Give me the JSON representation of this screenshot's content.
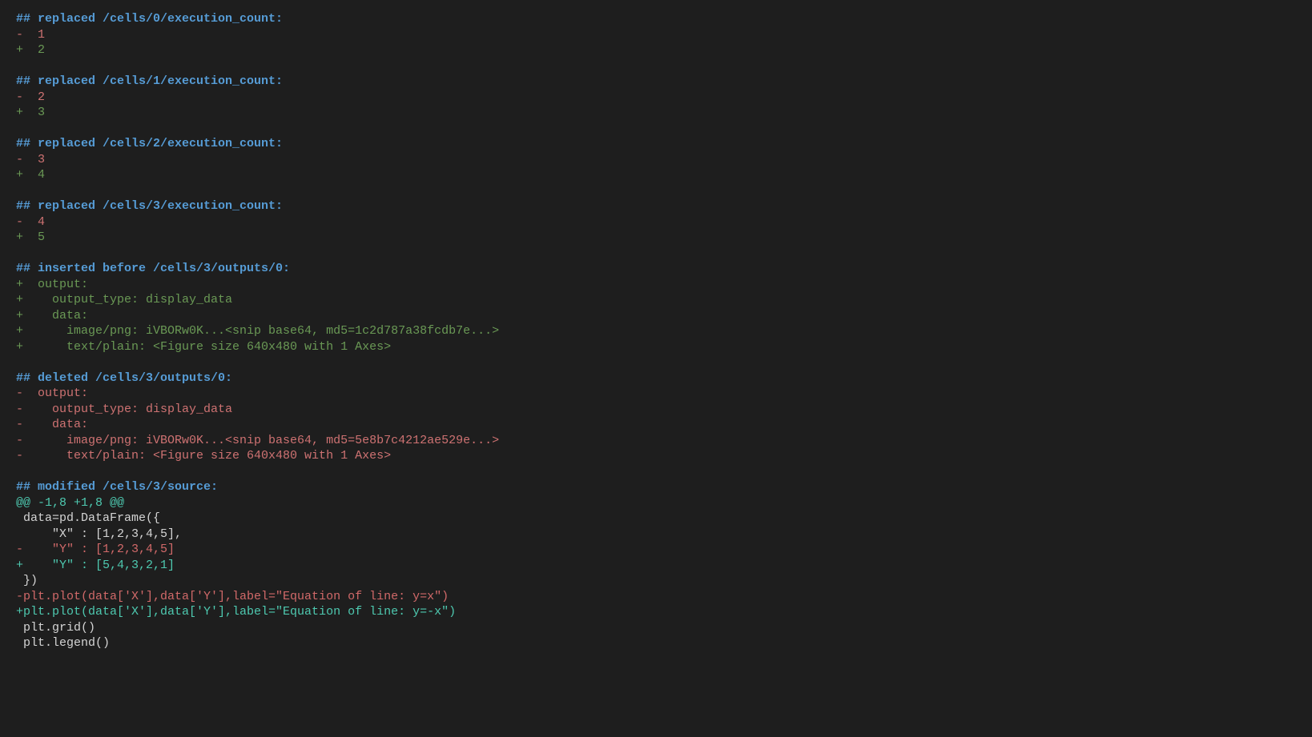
{
  "top_link": "",
  "sections": [
    {
      "type": "header",
      "text": "## replaced /cells/0/execution_count:"
    },
    {
      "type": "del",
      "text": "-  1"
    },
    {
      "type": "add",
      "text": "+  2"
    },
    {
      "type": "blank",
      "text": ""
    },
    {
      "type": "header",
      "text": "## replaced /cells/1/execution_count:"
    },
    {
      "type": "del",
      "text": "-  2"
    },
    {
      "type": "add",
      "text": "+  3"
    },
    {
      "type": "blank",
      "text": ""
    },
    {
      "type": "header",
      "text": "## replaced /cells/2/execution_count:"
    },
    {
      "type": "del",
      "text": "-  3"
    },
    {
      "type": "add",
      "text": "+  4"
    },
    {
      "type": "blank",
      "text": ""
    },
    {
      "type": "header",
      "text": "## replaced /cells/3/execution_count:"
    },
    {
      "type": "del",
      "text": "-  4"
    },
    {
      "type": "add",
      "text": "+  5"
    },
    {
      "type": "blank",
      "text": ""
    },
    {
      "type": "header",
      "text": "## inserted before /cells/3/outputs/0:"
    },
    {
      "type": "add",
      "text": "+  output:"
    },
    {
      "type": "add",
      "text": "+    output_type: display_data"
    },
    {
      "type": "add",
      "text": "+    data:"
    },
    {
      "type": "add",
      "text": "+      image/png: iVBORw0K...<snip base64, md5=1c2d787a38fcdb7e...>"
    },
    {
      "type": "add",
      "text": "+      text/plain: <Figure size 640x480 with 1 Axes>"
    },
    {
      "type": "blank",
      "text": ""
    },
    {
      "type": "header",
      "text": "## deleted /cells/3/outputs/0:"
    },
    {
      "type": "del",
      "text": "-  output:"
    },
    {
      "type": "del",
      "text": "-    output_type: display_data"
    },
    {
      "type": "del",
      "text": "-    data:"
    },
    {
      "type": "del",
      "text": "-      image/png: iVBORw0K...<snip base64, md5=5e8b7c4212ae529e...>"
    },
    {
      "type": "del",
      "text": "-      text/plain: <Figure size 640x480 with 1 Axes>"
    },
    {
      "type": "blank",
      "text": ""
    },
    {
      "type": "header",
      "text": "## modified /cells/3/source:"
    },
    {
      "type": "hunk",
      "text": "@@ -1,8 +1,8 @@"
    },
    {
      "type": "ctx",
      "text": " data=pd.DataFrame({"
    },
    {
      "type": "ctx",
      "text": "     \"X\" : [1,2,3,4,5],"
    },
    {
      "type": "del-bright",
      "text": "-    \"Y\" : [1,2,3,4,5]"
    },
    {
      "type": "add-bright",
      "text": "+    \"Y\" : [5,4,3,2,1]"
    },
    {
      "type": "ctx",
      "text": " })"
    },
    {
      "type": "del-bright",
      "text": "-plt.plot(data['X'],data['Y'],label=\"Equation of line: y=x\")"
    },
    {
      "type": "add-bright",
      "text": "+plt.plot(data['X'],data['Y'],label=\"Equation of line: y=-x\")"
    },
    {
      "type": "ctx",
      "text": " plt.grid()"
    },
    {
      "type": "ctx",
      "text": " plt.legend()"
    }
  ]
}
